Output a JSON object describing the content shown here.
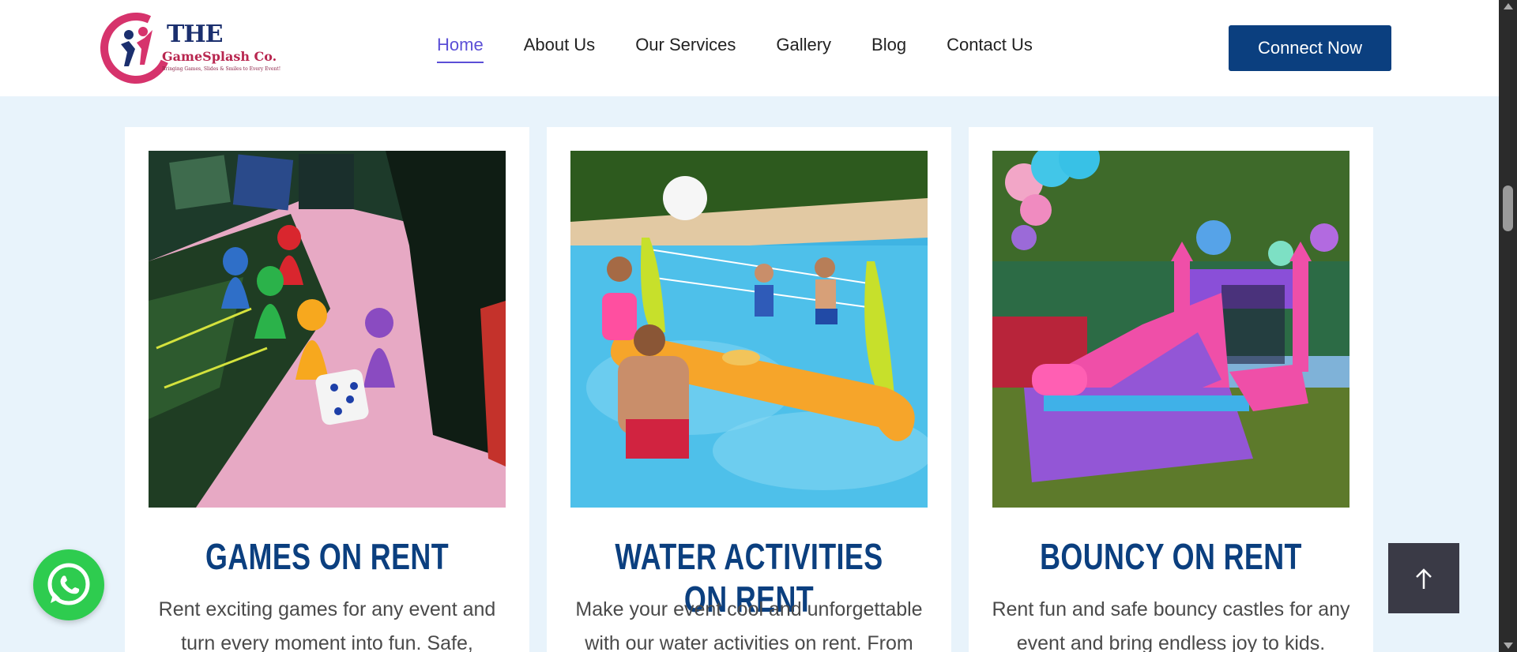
{
  "header": {
    "logo": {
      "line1": "THE",
      "line2": "GameSplash Co.",
      "tagline": "Bringing Games, Slides & Smiles to Every Event!"
    },
    "nav": [
      {
        "label": "Home",
        "active": true
      },
      {
        "label": "About Us",
        "active": false
      },
      {
        "label": "Our Services",
        "active": false
      },
      {
        "label": "Gallery",
        "active": false
      },
      {
        "label": "Blog",
        "active": false
      },
      {
        "label": "Contact Us",
        "active": false
      }
    ],
    "cta_label": "Connect Now"
  },
  "cards": [
    {
      "title": "GAMES ON RENT",
      "description": "Rent exciting games for any event and turn every moment into fun. Safe,",
      "image": "board-game-pawns-and-dice"
    },
    {
      "title": "WATER ACTIVITIES ON RENT",
      "description": "Make your event cool and unforgettable with our water activities on rent. From",
      "image": "family-pool-volleyball"
    },
    {
      "title": "BOUNCY ON RENT",
      "description": "Rent fun and safe bouncy castles for any event and bring endless joy to kids.",
      "image": "inflatable-bouncy-slide-with-balloons"
    }
  ],
  "floating": {
    "whatsapp_icon": "whatsapp-icon",
    "back_to_top_icon": "arrow-up-icon"
  },
  "colors": {
    "brand_blue": "#0b3f7f",
    "nav_active": "#5b4fd6",
    "page_bg": "#e8f3fb",
    "whatsapp_green": "#2ecc4f"
  }
}
